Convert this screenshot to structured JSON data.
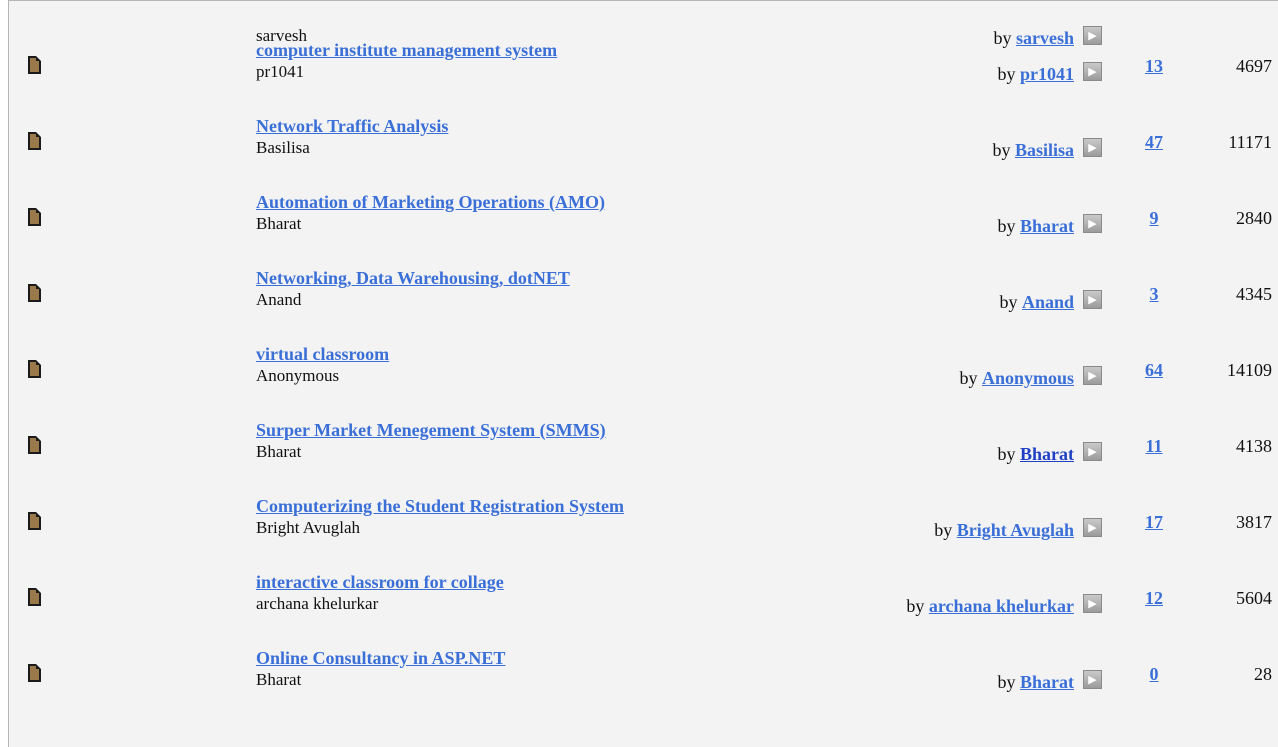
{
  "by_prefix": "by",
  "rows": [
    {
      "title": "",
      "author": "sarvesh",
      "by_name": "sarvesh",
      "replies": "",
      "views": ""
    },
    {
      "title": "computer institute management system",
      "author": "pr1041",
      "by_name": "pr1041",
      "replies": "13",
      "views": "4697"
    },
    {
      "title": "Network Traffic Analysis",
      "author": "Basilisa",
      "by_name": "Basilisa",
      "replies": "47",
      "views": "11171"
    },
    {
      "title": "Automation of Marketing Operations (AMO)",
      "author": "Bharat",
      "by_name": "Bharat",
      "replies": "9",
      "views": "2840"
    },
    {
      "title": "Networking, Data Warehousing, dotNET",
      "author": "Anand",
      "by_name": "Anand",
      "replies": "3",
      "views": "4345"
    },
    {
      "title": "virtual classroom",
      "author": "Anonymous",
      "by_name": "Anonymous",
      "replies": "64",
      "views": "14109"
    },
    {
      "title": "Surper Market Menegement System (SMMS)",
      "author": "Bharat",
      "by_name": "Bharat",
      "replies": "11",
      "views": "4138"
    },
    {
      "title": "Computerizing the Student Registration System",
      "author": "Bright Avuglah",
      "by_name": "Bright Avuglah",
      "replies": "17",
      "views": "3817"
    },
    {
      "title": "interactive classroom for collage",
      "author": "archana khelurkar",
      "by_name": "archana khelurkar",
      "replies": "12",
      "views": "5604"
    },
    {
      "title": "Online Consultancy in ASP.NET",
      "author": "Bharat",
      "by_name": "Bharat",
      "replies": "0",
      "views": "28"
    }
  ],
  "icons": {
    "topic": "document-icon",
    "last_post": "arrow-right-icon"
  },
  "colors": {
    "link": "#3a6fd8",
    "background": "#f3f3f3",
    "icon_fill": "#9a7a4a"
  }
}
